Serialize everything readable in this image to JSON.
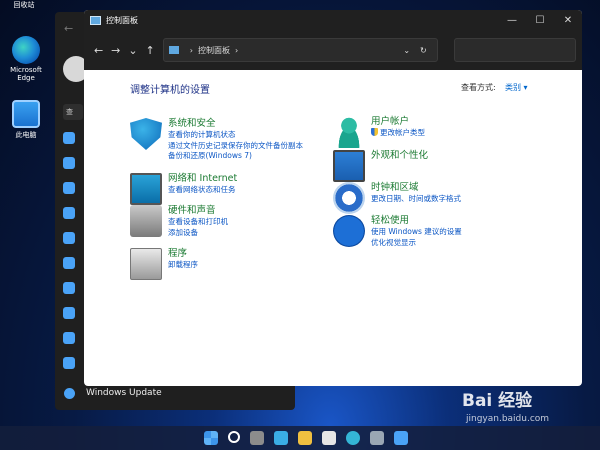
{
  "desktop": {
    "recycle_label": "回收站",
    "edge_label_1": "Microsoft",
    "edge_label_2": "Edge",
    "pc_label": "此电脑"
  },
  "settings_window": {
    "search_text": "查",
    "footer_label": "Windows Update"
  },
  "window": {
    "title": "控制面板",
    "controls": {
      "minimize": "—",
      "maximize": "☐",
      "close": "✕"
    }
  },
  "address": {
    "back": "←",
    "forward": "→",
    "dropdown": "⌄",
    "up": "↑",
    "path": "控制面板",
    "separator": "›",
    "path_dropdown": "⌄",
    "refresh": "↻"
  },
  "content": {
    "heading": "调整计算机的设置",
    "view_by_label": "查看方式:",
    "view_by_value": "类别 ▾"
  },
  "categories_left": [
    {
      "title": "系统和安全",
      "icon": "shield-icon",
      "links": [
        "查看你的计算机状态",
        "通过文件历史记录保存你的文件备份副本",
        "备份和还原(Windows 7)"
      ]
    },
    {
      "title": "网络和 Internet",
      "icon": "network-icon",
      "links": [
        "查看网络状态和任务"
      ]
    },
    {
      "title": "硬件和声音",
      "icon": "printer-icon",
      "links": [
        "查看设备和打印机",
        "添加设备"
      ]
    },
    {
      "title": "程序",
      "icon": "programs-icon",
      "links": [
        "卸载程序"
      ]
    }
  ],
  "categories_right": [
    {
      "title": "用户帐户",
      "icon": "user-icon",
      "links": [
        "更改帐户类型"
      ]
    },
    {
      "title": "外观和个性化",
      "icon": "appearance-icon",
      "links": []
    },
    {
      "title": "时钟和区域",
      "icon": "clock-icon",
      "links": [
        "更改日期、时间或数字格式"
      ]
    },
    {
      "title": "轻松使用",
      "icon": "accessibility-icon",
      "links": [
        "使用 Windows 建议的设置",
        "优化视觉显示"
      ]
    }
  ],
  "watermark": {
    "text": "Bai 经验",
    "url": "jingyan.baidu.com"
  }
}
